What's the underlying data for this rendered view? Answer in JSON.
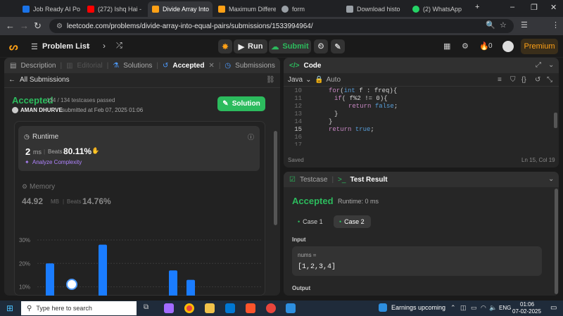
{
  "browser": {
    "tabs": [
      {
        "title": "Job Ready AI Po",
        "color": "#1a73e8"
      },
      {
        "title": "(272) Ishq Hai -",
        "color": "#ff0000"
      },
      {
        "title": "Divide Array Into",
        "color": "#ffa116"
      },
      {
        "title": "Maximum Differe",
        "color": "#ffa116"
      },
      {
        "title": "form",
        "color": "#9aa0a6"
      },
      {
        "title": "Download histo",
        "color": "#9aa0a6"
      },
      {
        "title": "(2) WhatsApp",
        "color": "#25d366"
      }
    ],
    "url": "leetcode.com/problems/divide-array-into-equal-pairs/submissions/1533994964/"
  },
  "header": {
    "problem_list": "Problem List",
    "run": "Run",
    "submit": "Submit",
    "streak": "0",
    "premium": "Premium"
  },
  "left": {
    "tabs": {
      "description": "Description",
      "editorial": "Editorial",
      "solutions": "Solutions",
      "accepted": "Accepted",
      "submissions": "Submissions"
    },
    "all_submissions": "All Submissions",
    "status": "Accepted",
    "testcases": "134 / 134 testcases passed",
    "user": "AMAN DHURVE",
    "submitted_at": "submitted at Feb 07, 2025 01:06",
    "solution_btn": "Solution",
    "runtime": {
      "label": "Runtime",
      "value": "2",
      "unit": "ms",
      "beats_label": "Beats",
      "beats": "80.11%",
      "analyze": "Analyze Complexity"
    },
    "memory": {
      "label": "Memory",
      "value": "44.92",
      "unit": "MB",
      "beats_label": "Beats",
      "beats": "14.76%"
    }
  },
  "chart_data": {
    "type": "bar",
    "ylabels": [
      "30%",
      "20%",
      "10%"
    ],
    "values": [
      20,
      28,
      17,
      13
    ],
    "ylim": [
      0,
      30
    ]
  },
  "code": {
    "title": "Code",
    "language": "Java",
    "auto": "Auto",
    "lines": [
      {
        "n": "10",
        "text": "for(int f : freq){"
      },
      {
        "n": "11",
        "text": "if( f%2 != 0){"
      },
      {
        "n": "12",
        "text": "return false;"
      },
      {
        "n": "13",
        "text": "}"
      },
      {
        "n": "14",
        "text": "}"
      },
      {
        "n": "15",
        "text": "return true;"
      },
      {
        "n": "16",
        "text": ""
      },
      {
        "n": "17",
        "text": ""
      }
    ],
    "saved": "Saved",
    "position": "Ln 15, Col 19"
  },
  "result": {
    "tab_testcase": "Testcase",
    "tab_result": "Test Result",
    "status": "Accepted",
    "runtime": "Runtime: 0 ms",
    "case1": "Case 1",
    "case2": "Case 2",
    "input_label": "Input",
    "var_name": "nums =",
    "var_value": "[1,2,3,4]",
    "output_label": "Output"
  },
  "taskbar": {
    "search_placeholder": "Type here to search",
    "earnings": "Earnings upcoming",
    "lang": "ENG",
    "time": "01:06",
    "date": "07-02-2025"
  }
}
